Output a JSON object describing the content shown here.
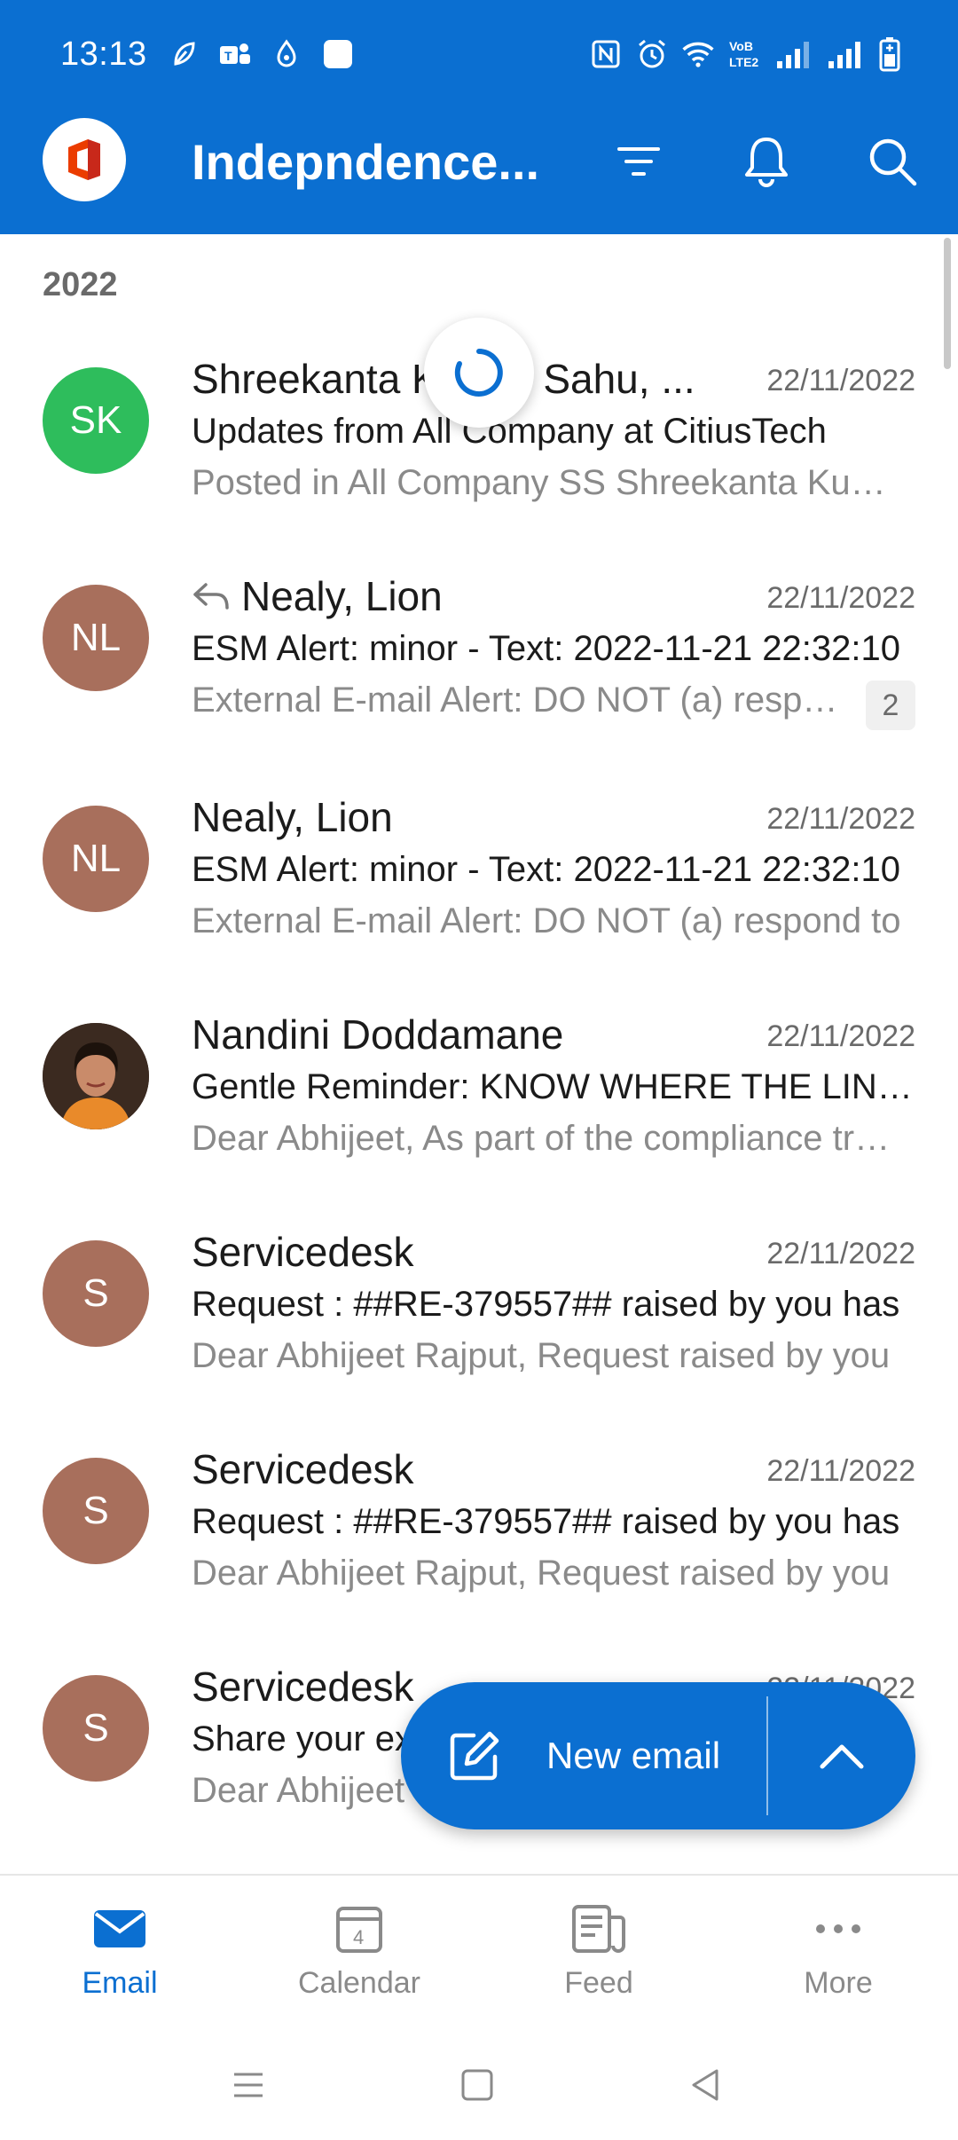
{
  "status_bar": {
    "time": "13:13",
    "left_icons": [
      "leaf-icon",
      "teams-icon",
      "notification-drop-icon",
      "square-app-icon"
    ],
    "right_icons": [
      "nfc-icon",
      "alarm-icon",
      "wifi-icon",
      "volte-icon",
      "signal-icon",
      "signal-icon",
      "battery-icon"
    ],
    "volte_text": "VoB LTE2"
  },
  "header": {
    "folder_title": "Indepndence...",
    "filter_icon": "filter-icon",
    "bell_icon": "bell-icon",
    "search_icon": "search-icon",
    "accent_color": "#0b6fd1"
  },
  "list": {
    "section_header": "2022",
    "items": [
      {
        "avatar_initials": "SK",
        "avatar_color": "#2ebd5c",
        "sender": "Shreekanta Kumar Sahu, ...",
        "date": "22/11/2022",
        "subject": "Updates from All Company at CitiusTech",
        "preview": "Posted in All Company SS Shreekanta Kumar Sahu",
        "replied": false,
        "count": null
      },
      {
        "avatar_initials": "NL",
        "avatar_color": "#a86f5c",
        "sender": "Nealy, Lion",
        "date": "22/11/2022",
        "subject": "ESM Alert:  minor - Text: 2022-11-21 22:32:10",
        "preview": "External E-mail Alert: DO NOT (a) respond",
        "replied": true,
        "count": "2"
      },
      {
        "avatar_initials": "NL",
        "avatar_color": "#a86f5c",
        "sender": "Nealy, Lion",
        "date": "22/11/2022",
        "subject": "ESM Alert:  minor - Text: 2022-11-21 22:32:10",
        "preview": "External E-mail Alert: DO NOT (a) respond to",
        "replied": false,
        "count": null
      },
      {
        "avatar_initials": "",
        "avatar_color": "#3b2a20",
        "avatar_photo": true,
        "sender": "Nandini Doddamane",
        "date": "22/11/2022",
        "subject": "Gentle Reminder: KNOW WHERE THE LINE IS",
        "preview": "Dear Abhijeet, As part of the compliance training",
        "replied": false,
        "count": null
      },
      {
        "avatar_initials": "S",
        "avatar_color": "#a86f5c",
        "sender": "Servicedesk",
        "date": "22/11/2022",
        "subject": "Request : ##RE-379557## raised by you has",
        "preview": "Dear Abhijeet Rajput, Request raised by you",
        "replied": false,
        "count": null
      },
      {
        "avatar_initials": "S",
        "avatar_color": "#a86f5c",
        "sender": "Servicedesk",
        "date": "22/11/2022",
        "subject": "Request : ##RE-379557## raised by you has",
        "preview": "Dear Abhijeet Rajput, Request raised by you",
        "replied": false,
        "count": null
      },
      {
        "avatar_initials": "S",
        "avatar_color": "#a86f5c",
        "sender": "Servicedesk",
        "date": "22/11/2022",
        "subject": "Share your ex",
        "preview": "Dear Abhijeet",
        "replied": false,
        "count": null
      }
    ]
  },
  "fab": {
    "label": "New email",
    "compose_icon": "compose-icon",
    "expand_icon": "chevron-up-icon"
  },
  "bottom_nav": {
    "items": [
      {
        "label": "Email",
        "icon": "mail-icon",
        "active": true
      },
      {
        "label": "Calendar",
        "icon": "calendar-icon",
        "active": false,
        "badge": "4"
      },
      {
        "label": "Feed",
        "icon": "feed-icon",
        "active": false
      },
      {
        "label": "More",
        "icon": "more-icon",
        "active": false
      }
    ]
  },
  "system_nav": {
    "icons": [
      "menu-icon",
      "home-icon",
      "back-icon"
    ]
  }
}
